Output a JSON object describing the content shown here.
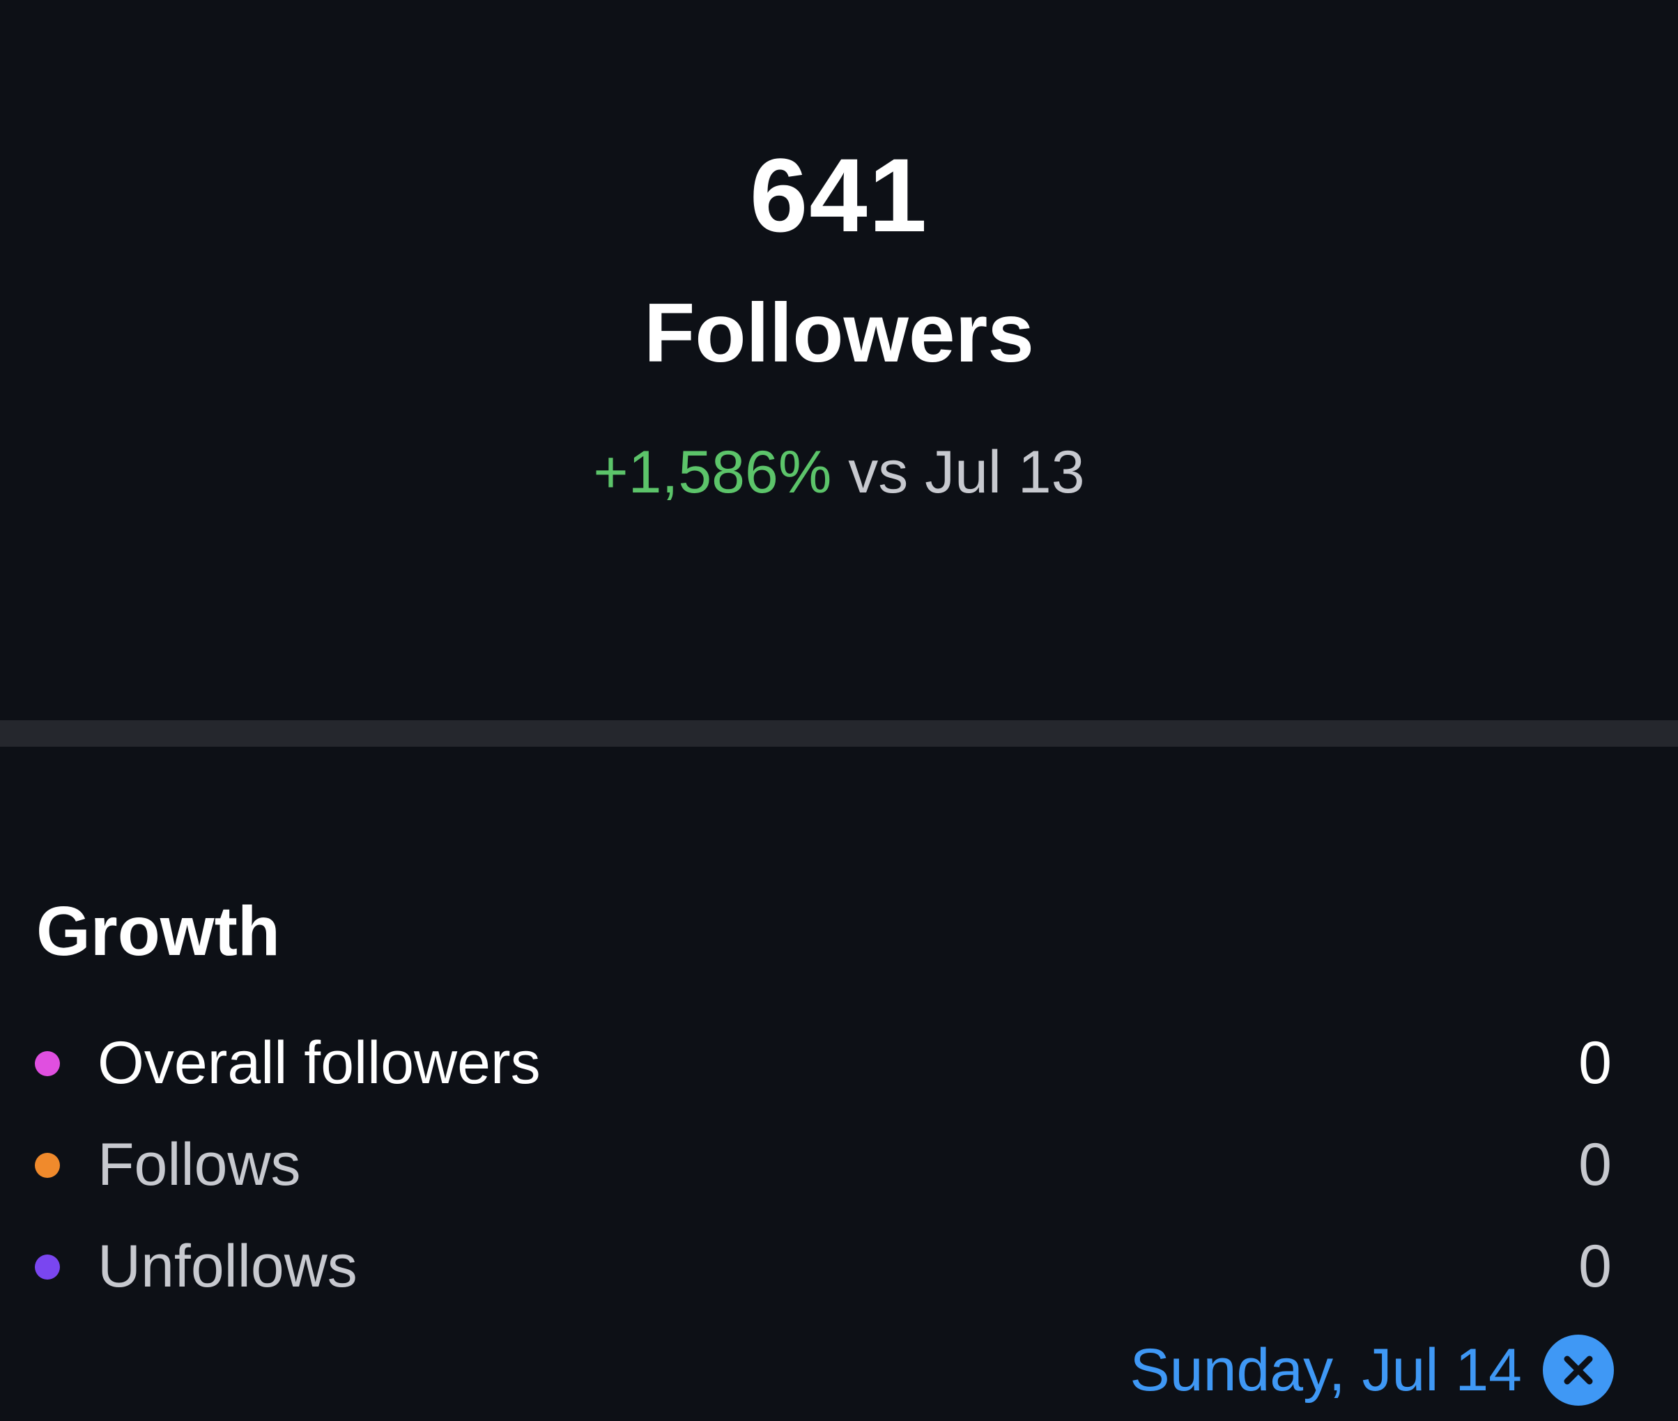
{
  "summary": {
    "value": "641",
    "label": "Followers",
    "change_percent": "+1,586%",
    "change_comparison": "vs Jul 13"
  },
  "growth": {
    "title": "Growth",
    "items": [
      {
        "label": "Overall followers",
        "value": "0",
        "dot_color": "#e04fe0"
      },
      {
        "label": "Follows",
        "value": "0",
        "dot_color": "#f08a2c"
      },
      {
        "label": "Unfollows",
        "value": "0",
        "dot_color": "#7a46f0"
      }
    ]
  },
  "selection": {
    "date_label": "Sunday, Jul 14",
    "clear_icon": "close-icon"
  },
  "colors": {
    "background": "#0d1016",
    "positive": "#5cc46a",
    "accent": "#3f98f5",
    "divider": "#25272d"
  }
}
